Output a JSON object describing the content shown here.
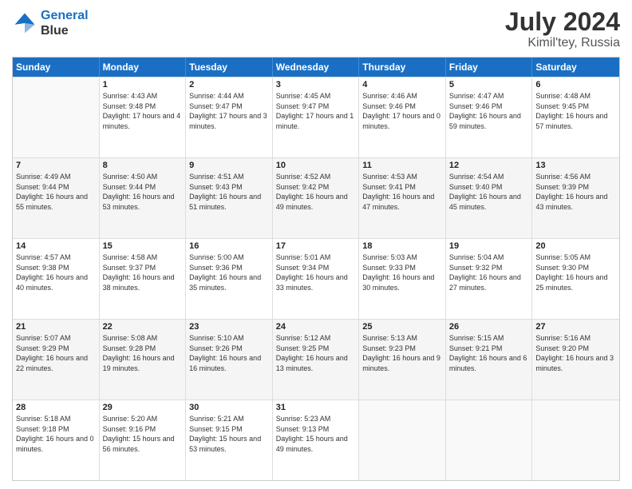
{
  "logo": {
    "line1": "General",
    "line2": "Blue"
  },
  "title": "July 2024",
  "location": "Kimil'tey, Russia",
  "header_days": [
    "Sunday",
    "Monday",
    "Tuesday",
    "Wednesday",
    "Thursday",
    "Friday",
    "Saturday"
  ],
  "weeks": [
    [
      {
        "day": "",
        "sunrise": "",
        "sunset": "",
        "daylight": ""
      },
      {
        "day": "1",
        "sunrise": "Sunrise: 4:43 AM",
        "sunset": "Sunset: 9:48 PM",
        "daylight": "Daylight: 17 hours and 4 minutes."
      },
      {
        "day": "2",
        "sunrise": "Sunrise: 4:44 AM",
        "sunset": "Sunset: 9:47 PM",
        "daylight": "Daylight: 17 hours and 3 minutes."
      },
      {
        "day": "3",
        "sunrise": "Sunrise: 4:45 AM",
        "sunset": "Sunset: 9:47 PM",
        "daylight": "Daylight: 17 hours and 1 minute."
      },
      {
        "day": "4",
        "sunrise": "Sunrise: 4:46 AM",
        "sunset": "Sunset: 9:46 PM",
        "daylight": "Daylight: 17 hours and 0 minutes."
      },
      {
        "day": "5",
        "sunrise": "Sunrise: 4:47 AM",
        "sunset": "Sunset: 9:46 PM",
        "daylight": "Daylight: 16 hours and 59 minutes."
      },
      {
        "day": "6",
        "sunrise": "Sunrise: 4:48 AM",
        "sunset": "Sunset: 9:45 PM",
        "daylight": "Daylight: 16 hours and 57 minutes."
      }
    ],
    [
      {
        "day": "7",
        "sunrise": "Sunrise: 4:49 AM",
        "sunset": "Sunset: 9:44 PM",
        "daylight": "Daylight: 16 hours and 55 minutes."
      },
      {
        "day": "8",
        "sunrise": "Sunrise: 4:50 AM",
        "sunset": "Sunset: 9:44 PM",
        "daylight": "Daylight: 16 hours and 53 minutes."
      },
      {
        "day": "9",
        "sunrise": "Sunrise: 4:51 AM",
        "sunset": "Sunset: 9:43 PM",
        "daylight": "Daylight: 16 hours and 51 minutes."
      },
      {
        "day": "10",
        "sunrise": "Sunrise: 4:52 AM",
        "sunset": "Sunset: 9:42 PM",
        "daylight": "Daylight: 16 hours and 49 minutes."
      },
      {
        "day": "11",
        "sunrise": "Sunrise: 4:53 AM",
        "sunset": "Sunset: 9:41 PM",
        "daylight": "Daylight: 16 hours and 47 minutes."
      },
      {
        "day": "12",
        "sunrise": "Sunrise: 4:54 AM",
        "sunset": "Sunset: 9:40 PM",
        "daylight": "Daylight: 16 hours and 45 minutes."
      },
      {
        "day": "13",
        "sunrise": "Sunrise: 4:56 AM",
        "sunset": "Sunset: 9:39 PM",
        "daylight": "Daylight: 16 hours and 43 minutes."
      }
    ],
    [
      {
        "day": "14",
        "sunrise": "Sunrise: 4:57 AM",
        "sunset": "Sunset: 9:38 PM",
        "daylight": "Daylight: 16 hours and 40 minutes."
      },
      {
        "day": "15",
        "sunrise": "Sunrise: 4:58 AM",
        "sunset": "Sunset: 9:37 PM",
        "daylight": "Daylight: 16 hours and 38 minutes."
      },
      {
        "day": "16",
        "sunrise": "Sunrise: 5:00 AM",
        "sunset": "Sunset: 9:36 PM",
        "daylight": "Daylight: 16 hours and 35 minutes."
      },
      {
        "day": "17",
        "sunrise": "Sunrise: 5:01 AM",
        "sunset": "Sunset: 9:34 PM",
        "daylight": "Daylight: 16 hours and 33 minutes."
      },
      {
        "day": "18",
        "sunrise": "Sunrise: 5:03 AM",
        "sunset": "Sunset: 9:33 PM",
        "daylight": "Daylight: 16 hours and 30 minutes."
      },
      {
        "day": "19",
        "sunrise": "Sunrise: 5:04 AM",
        "sunset": "Sunset: 9:32 PM",
        "daylight": "Daylight: 16 hours and 27 minutes."
      },
      {
        "day": "20",
        "sunrise": "Sunrise: 5:05 AM",
        "sunset": "Sunset: 9:30 PM",
        "daylight": "Daylight: 16 hours and 25 minutes."
      }
    ],
    [
      {
        "day": "21",
        "sunrise": "Sunrise: 5:07 AM",
        "sunset": "Sunset: 9:29 PM",
        "daylight": "Daylight: 16 hours and 22 minutes."
      },
      {
        "day": "22",
        "sunrise": "Sunrise: 5:08 AM",
        "sunset": "Sunset: 9:28 PM",
        "daylight": "Daylight: 16 hours and 19 minutes."
      },
      {
        "day": "23",
        "sunrise": "Sunrise: 5:10 AM",
        "sunset": "Sunset: 9:26 PM",
        "daylight": "Daylight: 16 hours and 16 minutes."
      },
      {
        "day": "24",
        "sunrise": "Sunrise: 5:12 AM",
        "sunset": "Sunset: 9:25 PM",
        "daylight": "Daylight: 16 hours and 13 minutes."
      },
      {
        "day": "25",
        "sunrise": "Sunrise: 5:13 AM",
        "sunset": "Sunset: 9:23 PM",
        "daylight": "Daylight: 16 hours and 9 minutes."
      },
      {
        "day": "26",
        "sunrise": "Sunrise: 5:15 AM",
        "sunset": "Sunset: 9:21 PM",
        "daylight": "Daylight: 16 hours and 6 minutes."
      },
      {
        "day": "27",
        "sunrise": "Sunrise: 5:16 AM",
        "sunset": "Sunset: 9:20 PM",
        "daylight": "Daylight: 16 hours and 3 minutes."
      }
    ],
    [
      {
        "day": "28",
        "sunrise": "Sunrise: 5:18 AM",
        "sunset": "Sunset: 9:18 PM",
        "daylight": "Daylight: 16 hours and 0 minutes."
      },
      {
        "day": "29",
        "sunrise": "Sunrise: 5:20 AM",
        "sunset": "Sunset: 9:16 PM",
        "daylight": "Daylight: 15 hours and 56 minutes."
      },
      {
        "day": "30",
        "sunrise": "Sunrise: 5:21 AM",
        "sunset": "Sunset: 9:15 PM",
        "daylight": "Daylight: 15 hours and 53 minutes."
      },
      {
        "day": "31",
        "sunrise": "Sunrise: 5:23 AM",
        "sunset": "Sunset: 9:13 PM",
        "daylight": "Daylight: 15 hours and 49 minutes."
      },
      {
        "day": "",
        "sunrise": "",
        "sunset": "",
        "daylight": ""
      },
      {
        "day": "",
        "sunrise": "",
        "sunset": "",
        "daylight": ""
      },
      {
        "day": "",
        "sunrise": "",
        "sunset": "",
        "daylight": ""
      }
    ]
  ]
}
